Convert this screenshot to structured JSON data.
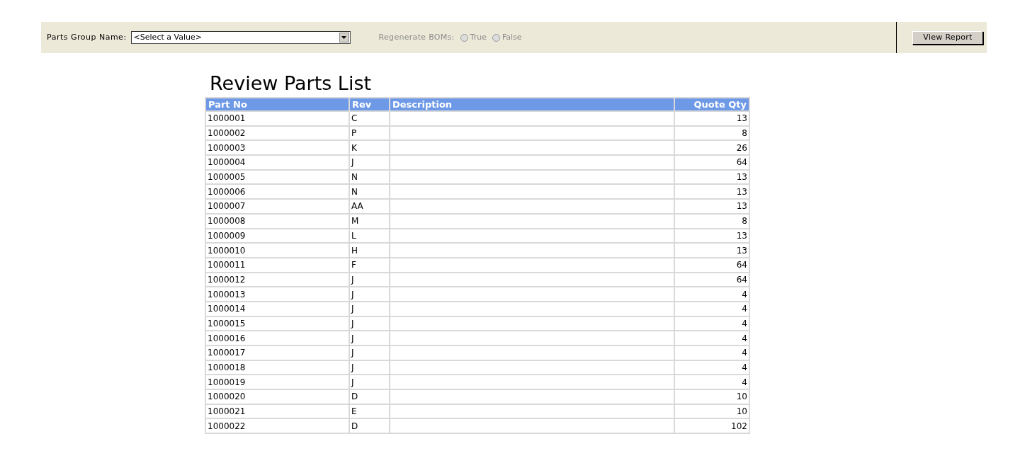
{
  "toolbar": {
    "parts_group": {
      "label": "Parts Group Name:",
      "value": "<Select a Value>"
    },
    "regenerate_boms": {
      "label": "Regenerate BOMs:",
      "disabled": true,
      "options": [
        {
          "label": "True",
          "selected": false
        },
        {
          "label": "False",
          "selected": false
        }
      ]
    },
    "view_report_button": "View Report"
  },
  "report": {
    "title": "Review Parts List",
    "columns": [
      "Part No",
      "Rev",
      "Description",
      "Quote Qty"
    ],
    "rows": [
      {
        "part_no": "1000001",
        "rev": "C",
        "quote_qty": "13"
      },
      {
        "part_no": "1000002",
        "rev": "P",
        "quote_qty": "8"
      },
      {
        "part_no": "1000003",
        "rev": "K",
        "quote_qty": "26"
      },
      {
        "part_no": "1000004",
        "rev": "J",
        "quote_qty": "64"
      },
      {
        "part_no": "1000005",
        "rev": "N",
        "quote_qty": "13"
      },
      {
        "part_no": "1000006",
        "rev": "N",
        "quote_qty": "13"
      },
      {
        "part_no": "1000007",
        "rev": "AA",
        "quote_qty": "13"
      },
      {
        "part_no": "1000008",
        "rev": "M",
        "quote_qty": "8"
      },
      {
        "part_no": "1000009",
        "rev": "L",
        "quote_qty": "13"
      },
      {
        "part_no": "1000010",
        "rev": "H",
        "quote_qty": "13"
      },
      {
        "part_no": "1000011",
        "rev": "F",
        "quote_qty": "64"
      },
      {
        "part_no": "1000012",
        "rev": "J",
        "quote_qty": "64"
      },
      {
        "part_no": "1000013",
        "rev": "J",
        "quote_qty": "4"
      },
      {
        "part_no": "1000014",
        "rev": "J",
        "quote_qty": "4"
      },
      {
        "part_no": "1000015",
        "rev": "J",
        "quote_qty": "4"
      },
      {
        "part_no": "1000016",
        "rev": "J",
        "quote_qty": "4"
      },
      {
        "part_no": "1000017",
        "rev": "J",
        "quote_qty": "4"
      },
      {
        "part_no": "1000018",
        "rev": "J",
        "quote_qty": "4"
      },
      {
        "part_no": "1000019",
        "rev": "J",
        "quote_qty": "4"
      },
      {
        "part_no": "1000020",
        "rev": "D",
        "quote_qty": "10"
      },
      {
        "part_no": "1000021",
        "rev": "E",
        "quote_qty": "10"
      },
      {
        "part_no": "1000022",
        "rev": "D",
        "quote_qty": "102"
      }
    ]
  }
}
